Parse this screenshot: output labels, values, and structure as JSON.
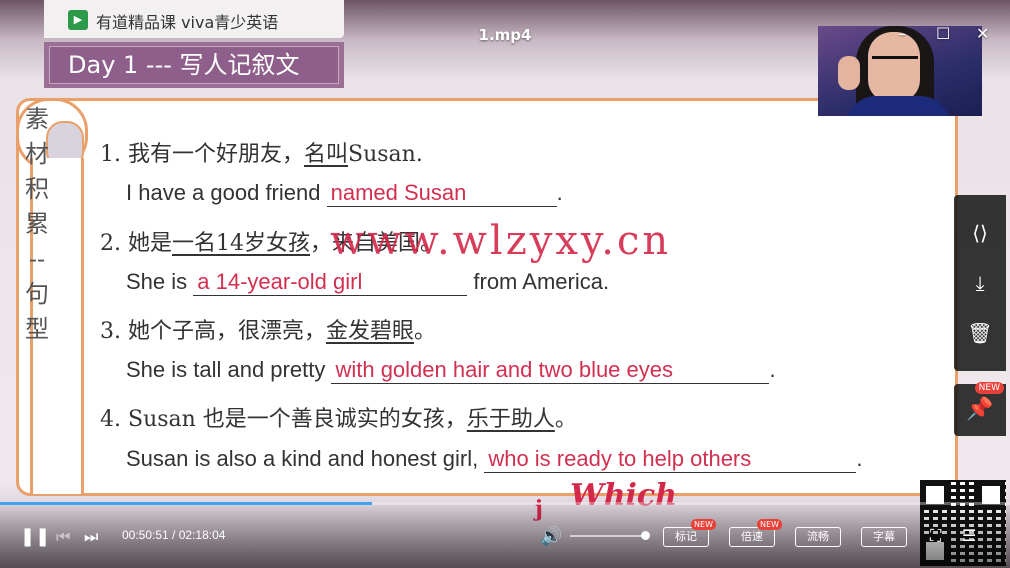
{
  "window": {
    "filename": "1.mp4"
  },
  "logo": {
    "mark": "▶",
    "text": "有道精品课    viva青少英语"
  },
  "banner": {
    "title": "Day 1 --- 写人记叙文"
  },
  "sidebar_vertical": [
    "素",
    "材",
    "积",
    "累",
    "--",
    "句",
    "型"
  ],
  "lesson": {
    "items": [
      {
        "cn_num": "1.",
        "cn_pre": " 我有一个好朋友，",
        "cn_ul": "名叫",
        "cn_post": "Susan.",
        "en_pre": "I have a good friend ",
        "en_answer": "named Susan",
        "en_post": "."
      },
      {
        "cn_num": "2.",
        "cn_pre": " 她是",
        "cn_ul": "一名14岁女孩",
        "cn_post": "，来自美国。",
        "en_pre": "She is ",
        "en_answer": "a 14-year-old girl",
        "en_post": " from America."
      },
      {
        "cn_num": "3.",
        "cn_pre": " 她个子高，很漂亮，",
        "cn_ul": "金发碧眼",
        "cn_post": "。",
        "en_pre": "She is tall and pretty ",
        "en_answer": "with golden hair and two blue eyes",
        "en_post": "."
      },
      {
        "cn_num": "4.",
        "cn_pre": " Susan 也是一个善良诚实的女孩，",
        "cn_ul": "乐于助人",
        "cn_post": "。",
        "en_pre": "Susan is also a kind and honest girl, ",
        "en_answer": "who is ready to help others",
        "en_post": "."
      }
    ]
  },
  "watermark": "www.wlzyxy.cn",
  "handwriting": {
    "word": "Which",
    "letter": "j"
  },
  "player": {
    "current_time": "00:50:51",
    "separator": " / ",
    "total_time": "02:18:04",
    "progress_fraction": 0.368,
    "volume_fraction": 1.0,
    "buttons": {
      "mark": "标记",
      "speed": "倍速",
      "quality": "流畅",
      "subtitle": "字幕"
    },
    "new_badge": "NEW"
  },
  "colors": {
    "accent_answer": "#d23050",
    "card_border": "#e9a06a",
    "banner": "#8e5f8b",
    "progress": "#3ea4f2"
  }
}
